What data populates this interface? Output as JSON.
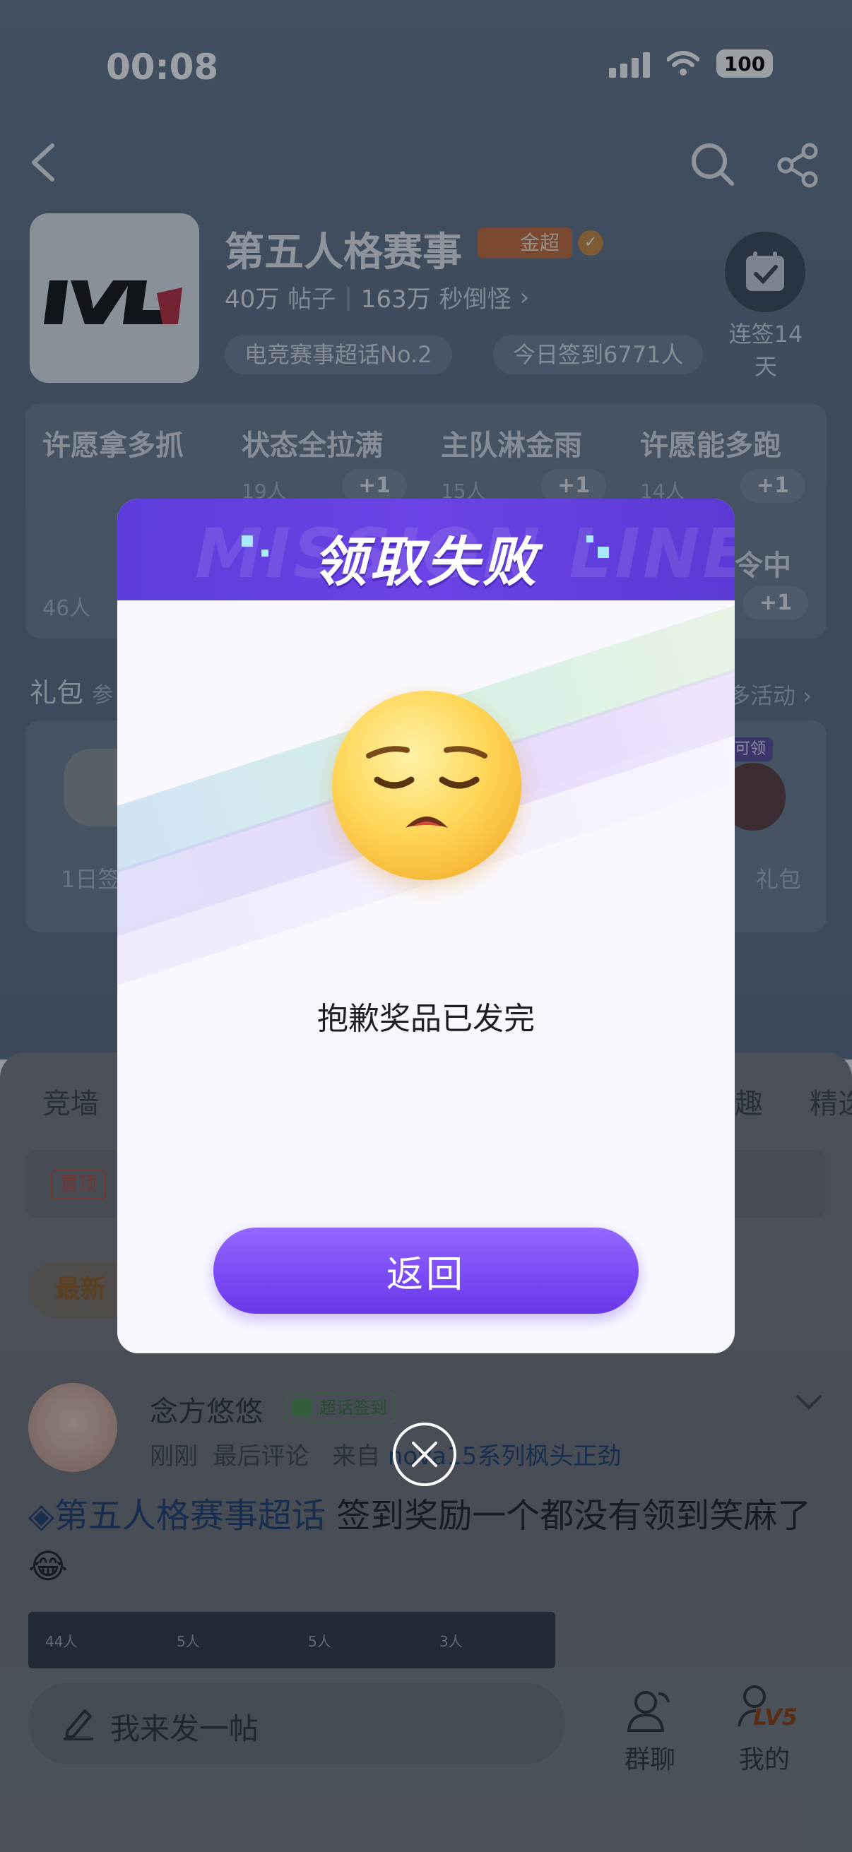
{
  "status_bar": {
    "time": "00:08",
    "battery": "100"
  },
  "forum": {
    "title": "第五人格赛事",
    "badge": "金超",
    "posts_num": "40万",
    "posts_label": "帖子",
    "members_num": "163万",
    "members_label": "秒倒怪",
    "tags": [
      "电竞赛事超话No.2",
      "今日签到6771人"
    ],
    "checkin_label": "连签14天"
  },
  "wishes": [
    {
      "name": "许愿拿多抓",
      "count": ""
    },
    {
      "name": "状态全拉满",
      "count": "19人"
    },
    {
      "name": "主队淋金雨",
      "count": "15人"
    },
    {
      "name": "许愿能多跑",
      "count": "14人"
    }
  ],
  "wish_plus": "+1",
  "wish_extra": {
    "count": "46人",
    "name_tail": "令中"
  },
  "gift": {
    "label": "礼包",
    "sub": "参",
    "more": "多活动",
    "item1": "1日签",
    "item2": "礼包",
    "ready": "可领"
  },
  "tabs": {
    "left": "竞墙",
    "right1": "趣",
    "right2": "精选"
  },
  "pinned": {
    "tag": "置顶"
  },
  "latest": "最新",
  "post": {
    "user": "念方悠悠",
    "user_badge": "超话签到",
    "meta_time": "刚刚",
    "meta_comment": "最后评论",
    "meta_from": "来自",
    "meta_device": "nova15系列枫头正劲",
    "topic": "第五人格赛事超话",
    "text": " 签到奖励一个都没有领到笑麻了😂",
    "thumb_counts": [
      "44人",
      "5人",
      "5人",
      "3人"
    ]
  },
  "bottom": {
    "compose": "我来发一帖",
    "group": "群聊",
    "mine": "我的",
    "level": "LV5"
  },
  "dialog": {
    "title": "领取失败",
    "bg_text": "MISSION LINE",
    "message": "抱歉奖品已发完",
    "button": "返回"
  },
  "colors": {
    "accent": "#7b4cf6",
    "header": "#5d3ddb"
  }
}
